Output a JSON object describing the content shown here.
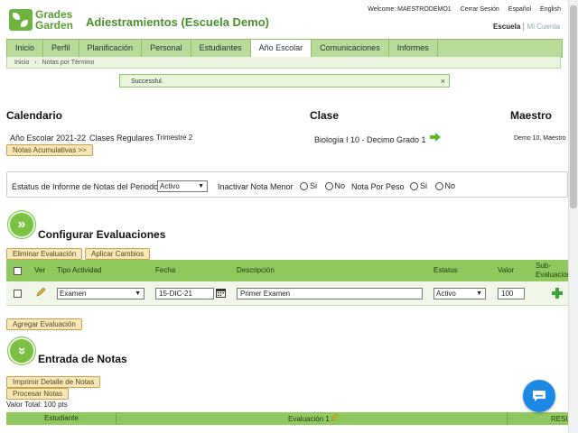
{
  "header": {
    "logo_line1": "Grades",
    "logo_line2": "Garden",
    "school_title": "Adiestramientos (Escuela Demo)",
    "welcome": "Welcome: MAESTRODEMO1",
    "logout": "Cerrar Sesión",
    "lang_es": "Español",
    "lang_en": "English",
    "switch_school": "Escuela",
    "switch_account": "Mi Cuenta"
  },
  "nav": {
    "tabs": [
      {
        "label": "Inicio"
      },
      {
        "label": "Perfil"
      },
      {
        "label": "Planificación"
      },
      {
        "label": "Personal"
      },
      {
        "label": "Estudiantes"
      },
      {
        "label": "Año Escolar"
      },
      {
        "label": "Comunicaciones"
      },
      {
        "label": "Informes"
      }
    ],
    "breadcrumb_home": "Inicio",
    "breadcrumb_sep": "›",
    "breadcrumb_current": "Notas por Término"
  },
  "flash": {
    "message": "Successful.",
    "close": "×"
  },
  "calendar": {
    "title": "Calendario",
    "year": "Año Escolar 2021-22",
    "classes": "Clases Regulares",
    "term": "Trimestre 2",
    "button": "Notas Acumulativas >>"
  },
  "clase": {
    "title": "Clase",
    "value": "Biología I 10 -  Decimo Grado  1"
  },
  "maestro": {
    "title": "Maestro",
    "value": "Demo 10, Maestro"
  },
  "options": {
    "status_label": "Estatus de Informe de Notas del Periodo",
    "status_value": "Activo",
    "inactivar_label": "Inactivar Nota Menor",
    "peso_label": "Nota Por Peso",
    "si": "Si",
    "no": "No"
  },
  "config": {
    "title": "Configurar Evaluaciones",
    "delete_btn": "Eliminar Evaluación",
    "apply_btn": "Aplicar Cambios",
    "add_btn": "Agregar Evaluación",
    "columns": {
      "ver": "Ver",
      "tipo": "Tipo Actividad",
      "fecha": "Fecha",
      "desc": "Descripción",
      "estatus": "Estatus",
      "valor": "Valor",
      "sub1": "Sub-",
      "sub2": "Evaluacion"
    },
    "row": {
      "tipo": "Examen",
      "fecha": "15-DIC-21",
      "desc": "Primer Examen",
      "estatus": "Activo",
      "valor": "100"
    }
  },
  "grades": {
    "title": "Entrada de Notas",
    "print_btn": "Imprimir Detalle de Notas",
    "process_btn": "Procesar Notas",
    "total": "Valor Total:  100 pts",
    "col_student": "Estudiante",
    "col_eval": "Evaluación 1",
    "col_result": "RESU"
  },
  "colors": {
    "brand_green": "#7ac143",
    "nav_green": "#b9db9a",
    "chat_blue": "#1e88e5"
  }
}
